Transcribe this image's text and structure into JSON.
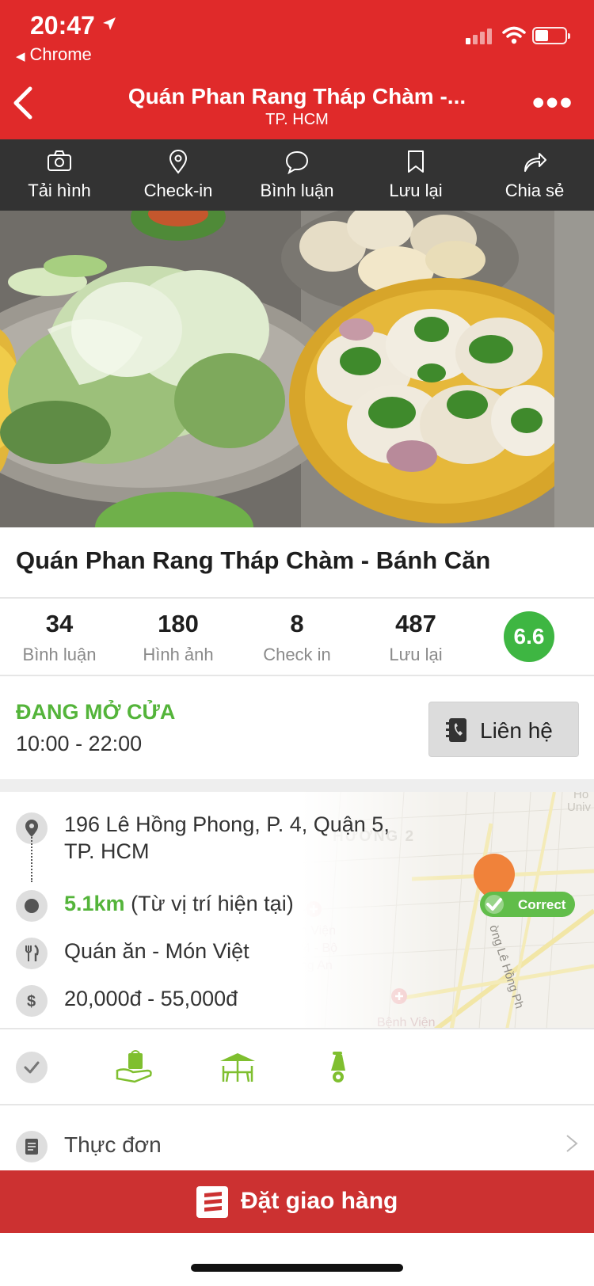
{
  "status_bar": {
    "time": "20:47",
    "back_app": "Chrome"
  },
  "nav": {
    "title": "Quán Phan Rang Tháp Chàm -...",
    "subtitle": "TP. HCM"
  },
  "actions": [
    {
      "label": "Tải hình",
      "icon": "camera-icon"
    },
    {
      "label": "Check-in",
      "icon": "location-pin-icon"
    },
    {
      "label": "Bình luận",
      "icon": "comment-icon"
    },
    {
      "label": "Lưu lại",
      "icon": "bookmark-icon"
    },
    {
      "label": "Chia sẻ",
      "icon": "share-icon"
    }
  ],
  "restaurant": {
    "name": "Quán Phan Rang Tháp Chàm - Bánh Căn",
    "score": "6.6"
  },
  "stats": [
    {
      "value": "34",
      "label": "Bình luận"
    },
    {
      "value": "180",
      "label": "Hình ảnh"
    },
    {
      "value": "8",
      "label": "Check in"
    },
    {
      "value": "487",
      "label": "Lưu lại"
    }
  ],
  "hours": {
    "status": "ĐANG MỞ CỬA",
    "time": "10:00 - 22:00",
    "contact_label": "Liên hệ"
  },
  "info": {
    "address_line1": "196 Lê Hồng Phong, P. 4, Quận 5,",
    "address_line2": "TP. HCM",
    "distance": "5.1km",
    "distance_note": "(Từ vị trí hiện tại)",
    "category": "Quán ăn - Món Việt",
    "price": "20,000đ - 55,000đ"
  },
  "map": {
    "correct_label": "Correct",
    "labels": {
      "ward": "HƯỜNG 2",
      "hospital_1": "nh Viện",
      "hospital_2": "0/4 - Bộ",
      "hospital_3": "ông An",
      "hospital_4": "Bệnh Viện",
      "street": "ờng Lê Hồng Ph",
      "corner_1": "Ho",
      "corner_2": "Univ"
    }
  },
  "amenities": [
    "takeaway-icon",
    "outdoor-seating-icon",
    "motorbike-parking-icon"
  ],
  "menu": {
    "label": "Thực đơn"
  },
  "order": {
    "label": "Đặt giao hàng"
  },
  "colors": {
    "brand_red": "#e02a2a",
    "toolbar": "#333333",
    "open_green": "#54b43a",
    "score_green": "#3eb642",
    "order_red": "#cc3131"
  }
}
